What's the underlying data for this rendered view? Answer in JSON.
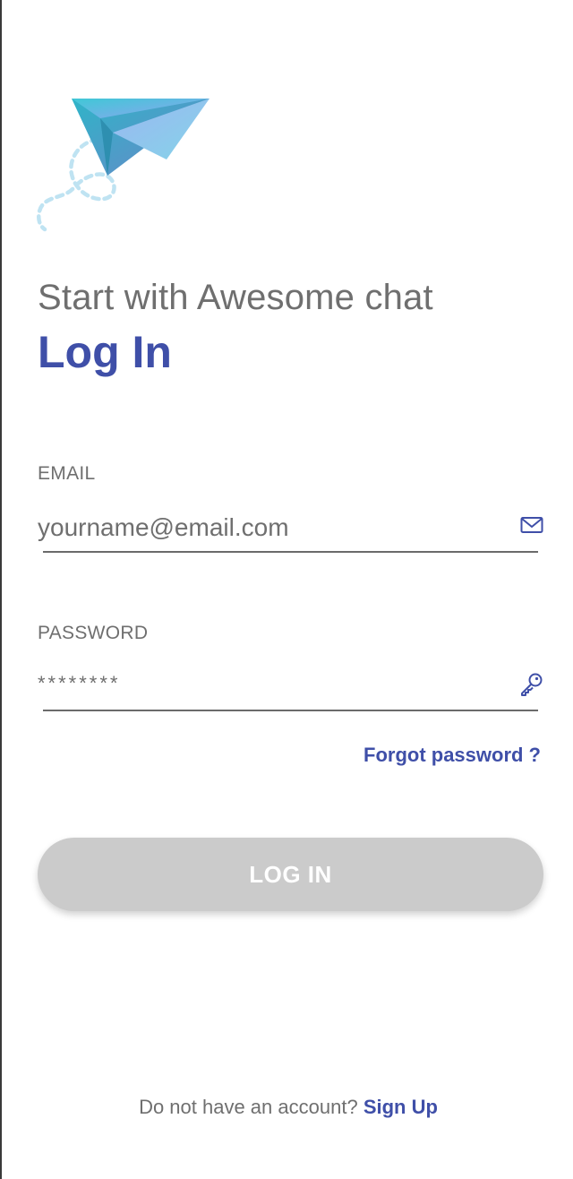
{
  "header": {
    "subtitle": "Start with Awesome chat",
    "title": "Log In"
  },
  "form": {
    "email": {
      "label": "EMAIL",
      "placeholder": "yourname@email.com",
      "icon": "mail-icon"
    },
    "password": {
      "label": "PASSWORD",
      "placeholder": "********",
      "icon": "key-icon"
    },
    "forgot_label": "Forgot password ?",
    "login_label": "LOG IN"
  },
  "footer": {
    "prompt": "Do not have an account?",
    "signup_label": "Sign Up"
  },
  "colors": {
    "accent": "#3f4fa8",
    "muted_text": "#6f6f6f",
    "button_disabled": "#cbcbcb"
  }
}
